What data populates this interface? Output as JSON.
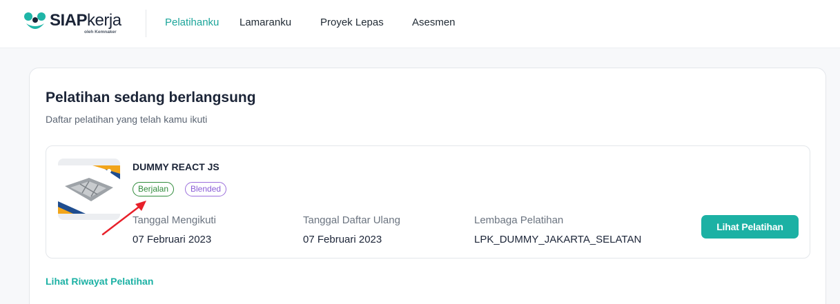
{
  "header": {
    "logo": {
      "brand_bold": "SIAP",
      "brand_light": "kerja",
      "tagline": "oleh Kemnaker",
      "mark_icon": "siapkerja-logo-mark"
    },
    "nav": [
      {
        "label": "Pelatihanku",
        "active": true
      },
      {
        "label": "Lamaranku",
        "active": false
      },
      {
        "label": "Proyek Lepas",
        "active": false
      },
      {
        "label": "Asesmen",
        "active": false
      }
    ]
  },
  "main": {
    "title": "Pelatihan sedang berlangsung",
    "subtitle": "Daftar pelatihan yang telah kamu ikuti",
    "training": {
      "name": "DUMMY REACT JS",
      "status_badge": "Berjalan",
      "type_badge": "Blended",
      "start_label": "Tanggal Mengikuti",
      "start_value": "07 Februari 2023",
      "reregister_label": "Tanggal Daftar Ulang",
      "reregister_value": "07 Februari 2023",
      "institution_label": "Lembaga Pelatihan",
      "institution_value": "LPK_DUMMY_JAKARTA_SELATAN",
      "action_label": "Lihat Pelatihan"
    },
    "history_link": "Lihat Riwayat Pelatihan"
  },
  "colors": {
    "accent": "#1cb1a4",
    "status_green": "#2f8a3a",
    "type_purple": "#8a5cd6",
    "annotation_arrow": "#e8202a"
  }
}
